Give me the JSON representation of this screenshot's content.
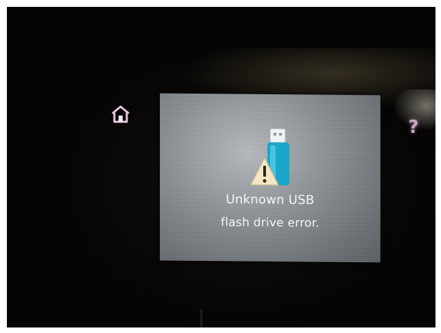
{
  "screen": {
    "message_line1": "Unknown USB",
    "message_line2": "flash drive error.",
    "icon": "usb-flash-drive-warning-icon"
  },
  "panel": {
    "home_icon": "home-icon",
    "help_label": "?"
  },
  "colors": {
    "screen_background": "#8c9196",
    "usb_drive_body": "#1aa7c9",
    "warning_triangle": "#f2e6c4",
    "button_glow": "#e8c9e2"
  }
}
